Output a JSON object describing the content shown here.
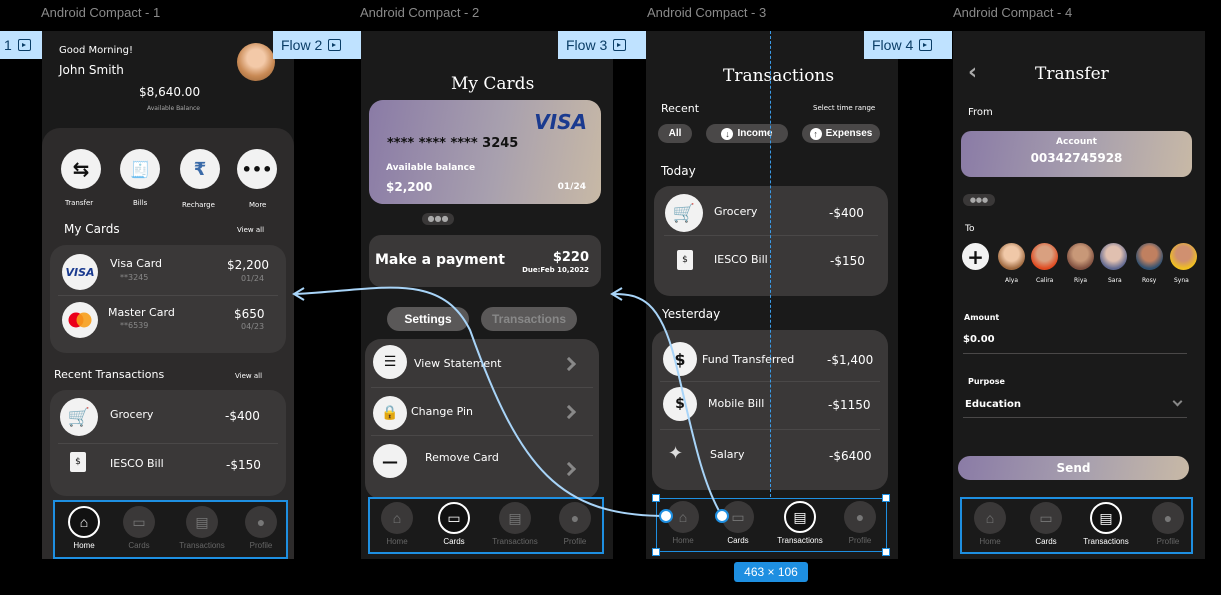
{
  "frames": {
    "f1": "Android Compact - 1",
    "f2": "Android Compact - 2",
    "f3": "Android Compact - 3",
    "f4": "Android Compact - 4"
  },
  "flows": {
    "f1": "1",
    "f2": "Flow 2",
    "f3": "Flow 3",
    "f4": "Flow 4"
  },
  "home": {
    "greeting": "Good Morning!",
    "name": "John Smith",
    "balance": "$8,640.00",
    "balance_label": "Available Balance",
    "actions": [
      "Transfer",
      "Bills",
      "Recharge",
      "More"
    ],
    "my_cards": "My Cards",
    "view_all": "View all",
    "cards": [
      {
        "name": "Visa Card",
        "num": "**3245",
        "amount": "$2,200",
        "exp": "01/24"
      },
      {
        "name": "Master Card",
        "num": "**6539",
        "amount": "$650",
        "exp": "04/23"
      }
    ],
    "recent": "Recent Transactions",
    "transactions": [
      {
        "name": "Grocery",
        "amount": "-$400"
      },
      {
        "name": "IESCO Bill",
        "amount": "-$150"
      }
    ]
  },
  "nav": {
    "home": "Home",
    "cards": "Cards",
    "transactions": "Transactions",
    "profile": "Profile"
  },
  "cards_screen": {
    "title": "My Cards",
    "brand": "VISA",
    "number": "**** **** **** 3245",
    "avail": "Available balance",
    "balance": "$2,200",
    "exp": "01/24",
    "pay_label": "Make a payment",
    "pay_amount": "$220",
    "pay_due": "Due:Feb 10,2022",
    "tab_settings": "Settings",
    "tab_transactions": "Transactions",
    "options": [
      "View Statement",
      "Change Pin",
      "Remove Card"
    ]
  },
  "tx_screen": {
    "title": "Transactions",
    "recent": "Recent",
    "time_range": "Select time range",
    "filters": [
      "All",
      "Income",
      "Expenses"
    ],
    "today": "Today",
    "today_items": [
      {
        "name": "Grocery",
        "amount": "-$400"
      },
      {
        "name": "IESCO Bill",
        "amount": "-$150"
      }
    ],
    "yesterday": "Yesterday",
    "yesterday_items": [
      {
        "name": "Fund Transferred",
        "amount": "-$1,400"
      },
      {
        "name": "Mobile Bill",
        "amount": "-$1150"
      },
      {
        "name": "Salary",
        "amount": "-$6400"
      }
    ],
    "selection_size": "463 × 106"
  },
  "transfer": {
    "title": "Transfer",
    "from": "From",
    "account_label": "Account",
    "account_number": "00342745928",
    "to": "To",
    "contacts": [
      "Alya",
      "Calira",
      "Riya",
      "Sara",
      "Rosy",
      "Syna"
    ],
    "amount_label": "Amount",
    "amount": "$0.00",
    "purpose_label": "Purpose",
    "purpose": "Education",
    "send": "Send"
  }
}
